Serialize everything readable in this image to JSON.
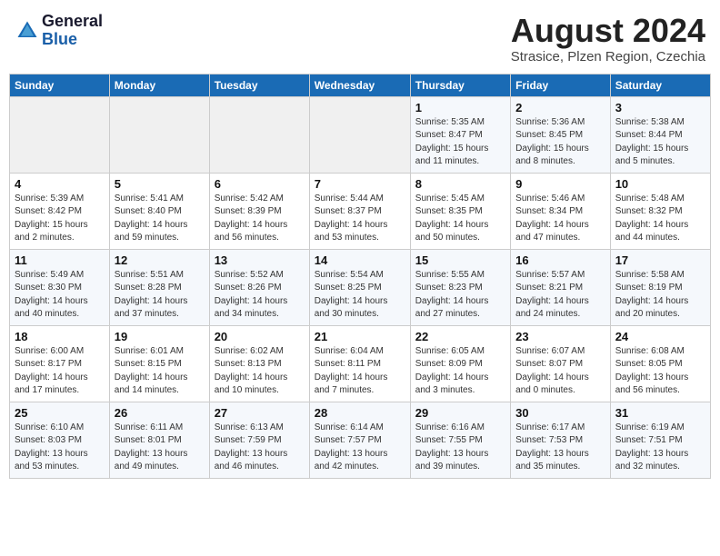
{
  "header": {
    "logo_general": "General",
    "logo_blue": "Blue",
    "month_title": "August 2024",
    "subtitle": "Strasice, Plzen Region, Czechia"
  },
  "days_of_week": [
    "Sunday",
    "Monday",
    "Tuesday",
    "Wednesday",
    "Thursday",
    "Friday",
    "Saturday"
  ],
  "weeks": [
    [
      {
        "day": "",
        "info": ""
      },
      {
        "day": "",
        "info": ""
      },
      {
        "day": "",
        "info": ""
      },
      {
        "day": "",
        "info": ""
      },
      {
        "day": "1",
        "info": "Sunrise: 5:35 AM\nSunset: 8:47 PM\nDaylight: 15 hours and 11 minutes."
      },
      {
        "day": "2",
        "info": "Sunrise: 5:36 AM\nSunset: 8:45 PM\nDaylight: 15 hours and 8 minutes."
      },
      {
        "day": "3",
        "info": "Sunrise: 5:38 AM\nSunset: 8:44 PM\nDaylight: 15 hours and 5 minutes."
      }
    ],
    [
      {
        "day": "4",
        "info": "Sunrise: 5:39 AM\nSunset: 8:42 PM\nDaylight: 15 hours and 2 minutes."
      },
      {
        "day": "5",
        "info": "Sunrise: 5:41 AM\nSunset: 8:40 PM\nDaylight: 14 hours and 59 minutes."
      },
      {
        "day": "6",
        "info": "Sunrise: 5:42 AM\nSunset: 8:39 PM\nDaylight: 14 hours and 56 minutes."
      },
      {
        "day": "7",
        "info": "Sunrise: 5:44 AM\nSunset: 8:37 PM\nDaylight: 14 hours and 53 minutes."
      },
      {
        "day": "8",
        "info": "Sunrise: 5:45 AM\nSunset: 8:35 PM\nDaylight: 14 hours and 50 minutes."
      },
      {
        "day": "9",
        "info": "Sunrise: 5:46 AM\nSunset: 8:34 PM\nDaylight: 14 hours and 47 minutes."
      },
      {
        "day": "10",
        "info": "Sunrise: 5:48 AM\nSunset: 8:32 PM\nDaylight: 14 hours and 44 minutes."
      }
    ],
    [
      {
        "day": "11",
        "info": "Sunrise: 5:49 AM\nSunset: 8:30 PM\nDaylight: 14 hours and 40 minutes."
      },
      {
        "day": "12",
        "info": "Sunrise: 5:51 AM\nSunset: 8:28 PM\nDaylight: 14 hours and 37 minutes."
      },
      {
        "day": "13",
        "info": "Sunrise: 5:52 AM\nSunset: 8:26 PM\nDaylight: 14 hours and 34 minutes."
      },
      {
        "day": "14",
        "info": "Sunrise: 5:54 AM\nSunset: 8:25 PM\nDaylight: 14 hours and 30 minutes."
      },
      {
        "day": "15",
        "info": "Sunrise: 5:55 AM\nSunset: 8:23 PM\nDaylight: 14 hours and 27 minutes."
      },
      {
        "day": "16",
        "info": "Sunrise: 5:57 AM\nSunset: 8:21 PM\nDaylight: 14 hours and 24 minutes."
      },
      {
        "day": "17",
        "info": "Sunrise: 5:58 AM\nSunset: 8:19 PM\nDaylight: 14 hours and 20 minutes."
      }
    ],
    [
      {
        "day": "18",
        "info": "Sunrise: 6:00 AM\nSunset: 8:17 PM\nDaylight: 14 hours and 17 minutes."
      },
      {
        "day": "19",
        "info": "Sunrise: 6:01 AM\nSunset: 8:15 PM\nDaylight: 14 hours and 14 minutes."
      },
      {
        "day": "20",
        "info": "Sunrise: 6:02 AM\nSunset: 8:13 PM\nDaylight: 14 hours and 10 minutes."
      },
      {
        "day": "21",
        "info": "Sunrise: 6:04 AM\nSunset: 8:11 PM\nDaylight: 14 hours and 7 minutes."
      },
      {
        "day": "22",
        "info": "Sunrise: 6:05 AM\nSunset: 8:09 PM\nDaylight: 14 hours and 3 minutes."
      },
      {
        "day": "23",
        "info": "Sunrise: 6:07 AM\nSunset: 8:07 PM\nDaylight: 14 hours and 0 minutes."
      },
      {
        "day": "24",
        "info": "Sunrise: 6:08 AM\nSunset: 8:05 PM\nDaylight: 13 hours and 56 minutes."
      }
    ],
    [
      {
        "day": "25",
        "info": "Sunrise: 6:10 AM\nSunset: 8:03 PM\nDaylight: 13 hours and 53 minutes."
      },
      {
        "day": "26",
        "info": "Sunrise: 6:11 AM\nSunset: 8:01 PM\nDaylight: 13 hours and 49 minutes."
      },
      {
        "day": "27",
        "info": "Sunrise: 6:13 AM\nSunset: 7:59 PM\nDaylight: 13 hours and 46 minutes."
      },
      {
        "day": "28",
        "info": "Sunrise: 6:14 AM\nSunset: 7:57 PM\nDaylight: 13 hours and 42 minutes."
      },
      {
        "day": "29",
        "info": "Sunrise: 6:16 AM\nSunset: 7:55 PM\nDaylight: 13 hours and 39 minutes."
      },
      {
        "day": "30",
        "info": "Sunrise: 6:17 AM\nSunset: 7:53 PM\nDaylight: 13 hours and 35 minutes."
      },
      {
        "day": "31",
        "info": "Sunrise: 6:19 AM\nSunset: 7:51 PM\nDaylight: 13 hours and 32 minutes."
      }
    ]
  ]
}
